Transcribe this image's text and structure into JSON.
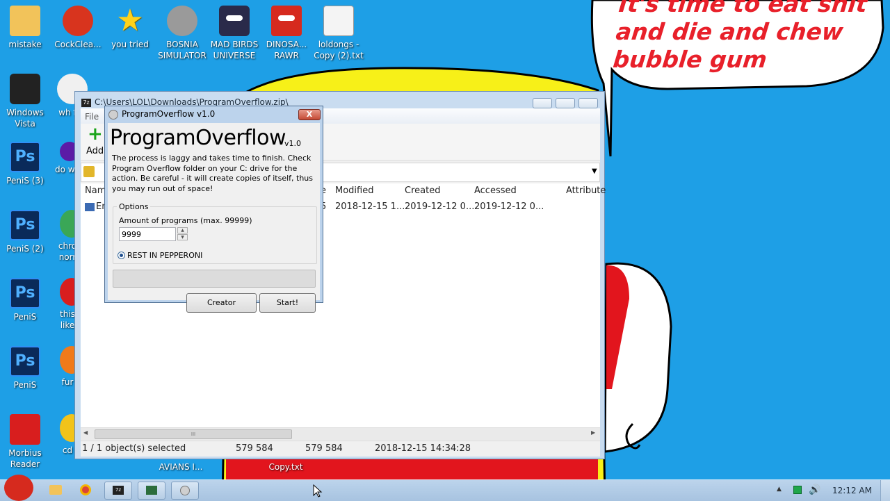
{
  "desktop": {
    "icons": [
      {
        "label": "mistake"
      },
      {
        "label": "CockClea..."
      },
      {
        "label": "you tried"
      },
      {
        "label": "BOSNIA SIMULATOR"
      },
      {
        "label": "MAD BIRDS UNIVERSE"
      },
      {
        "label": "DINOSA... RAWR"
      },
      {
        "label": "loldongs - Copy (2).txt"
      },
      {
        "label": "Windows Vista"
      },
      {
        "label": "wh fuc"
      },
      {
        "label": "PeniS (3)"
      },
      {
        "label": "do wo"
      },
      {
        "label": "PeniS (2)"
      },
      {
        "label": "chro norr"
      },
      {
        "label": "PeniS"
      },
      {
        "label": "this like"
      },
      {
        "label": "PeniS"
      },
      {
        "label": "fur"
      },
      {
        "label": "Morbius Reader"
      },
      {
        "label": "cd"
      },
      {
        "label": "AVIANS I..."
      },
      {
        "label": "Copy.txt"
      }
    ],
    "speech_bubble": [
      "It's time to eat shit",
      "and die and chew",
      "bubble gum"
    ]
  },
  "zip_window": {
    "title": "C:\\Users\\LOL\\Downloads\\ProgramOverflow.zip\\",
    "menu_file": "File",
    "toolbar_add": "Add",
    "columns": [
      "Nam",
      "e",
      "Modified",
      "Created",
      "Accessed",
      "Attribute"
    ],
    "row": {
      "name": "Er",
      "size_tail": "5",
      "modified": "2018-12-15 1...",
      "created": "2019-12-12 0...",
      "accessed": "2019-12-12 0..."
    },
    "scroll_glyph": "III",
    "status": {
      "selected": "1 / 1 object(s) selected",
      "size": "579 584",
      "packed": "579 584",
      "date": "2018-12-15 14:34:28"
    }
  },
  "dialog": {
    "title": "ProgramOverflow v1.0",
    "close_glyph": "X",
    "heading": "ProgramOverflow",
    "version": "v1.0",
    "description": "The process is laggy and takes time to finish. Check Program Overflow folder on your C: drive for the action. Be careful - it will create copies of itself, thus you may run out of space!",
    "options_label": "Options",
    "amount_label": "Amount of programs (max. 99999)",
    "amount_value": "9999",
    "radio_label": "REST IN PEPPERONI",
    "creator_button": "Creator",
    "start_button": "Start!",
    "progress": 0
  },
  "taskbar": {
    "clock": "12:12 AM"
  },
  "colors": {
    "desktop": "#1e9fe6",
    "bubble_text": "#e8202a",
    "window_frame": "#c9dcf0"
  }
}
